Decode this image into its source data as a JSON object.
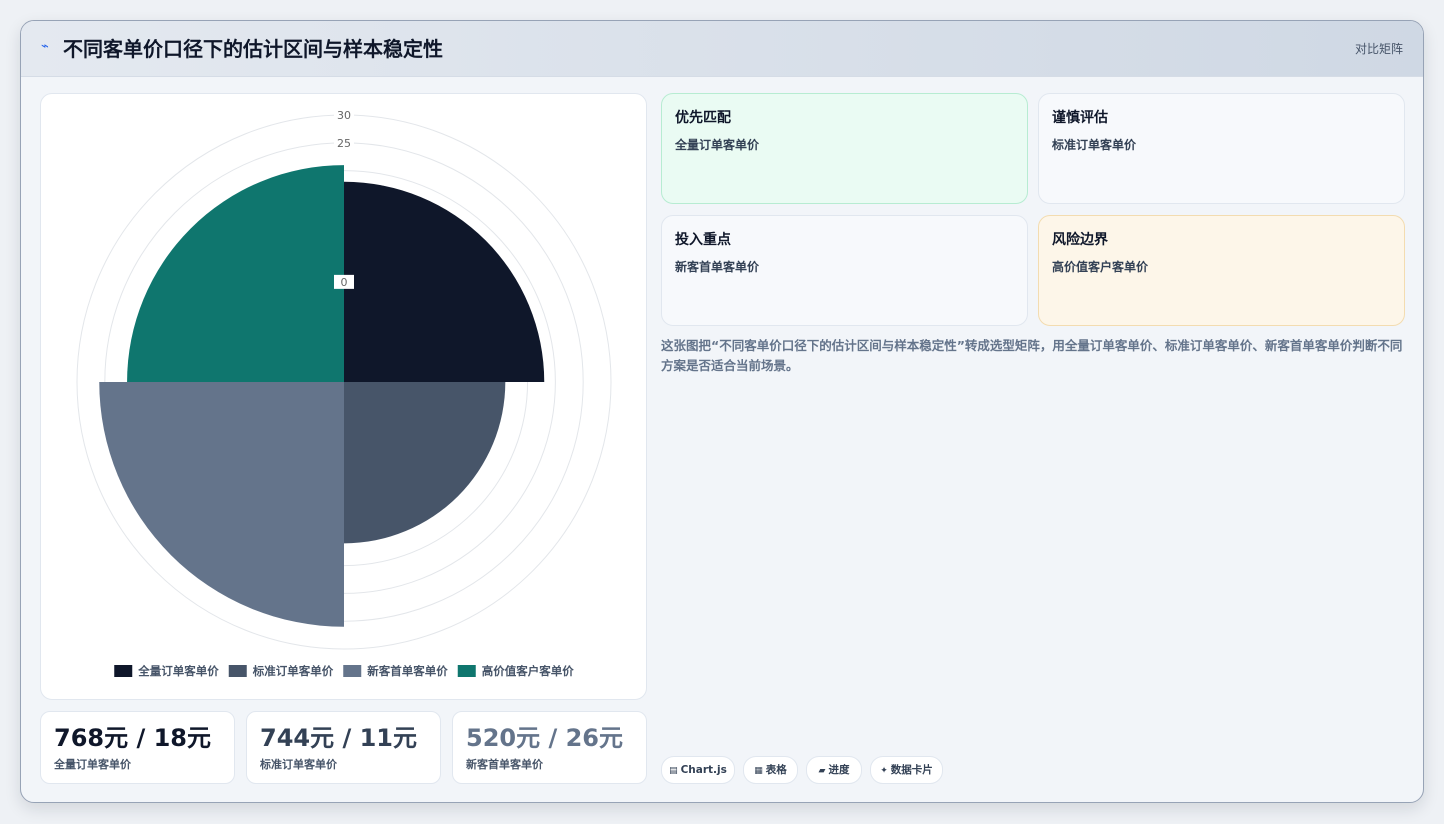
{
  "header": {
    "title": "不同客单价口径下的估计区间与样本稳定性",
    "right_link": "对比矩阵",
    "logo_icon": "pulse-icon"
  },
  "chart_data": {
    "type": "polarArea",
    "categories": [
      "全量订单客单价",
      "标准订单客单价",
      "新客首单客单价",
      "高价值客户客单价"
    ],
    "values": [
      18,
      11,
      26,
      21
    ],
    "colors": [
      "#0f172a",
      "#475569",
      "#64748b",
      "#0f766e"
    ],
    "radial_ticks": [
      0,
      25,
      30
    ],
    "rlim": [
      -18,
      30
    ],
    "legend_position": "bottom",
    "grid": true
  },
  "kpis": [
    {
      "value": "768元 / 18元",
      "label": "全量订单客单价",
      "color": "#0f172a"
    },
    {
      "value": "744元 / 11元",
      "label": "标准订单客单价",
      "color": "#334155"
    },
    {
      "value": "520元 / 26元",
      "label": "新客首单客单价",
      "color": "#64748b"
    }
  ],
  "tiles": [
    {
      "title": "优先匹配",
      "subtitle": "全量订单客单价"
    },
    {
      "title": "谨慎评估",
      "subtitle": "标准订单客单价"
    },
    {
      "title": "投入重点",
      "subtitle": "新客首单客单价"
    },
    {
      "title": "风险边界",
      "subtitle": "高价值客户客单价"
    }
  ],
  "description": "这张图把“不同客单价口径下的估计区间与样本稳定性”转成选型矩阵，用全量订单客单价、标准订单客单价、新客首单客单价判断不同方案是否适合当前场景。",
  "chips": [
    {
      "icon": "chart-icon",
      "label": "Chart.js"
    },
    {
      "icon": "table-icon",
      "label": "表格"
    },
    {
      "icon": "progress-icon",
      "label": "进度"
    },
    {
      "icon": "card-icon",
      "label": "数据卡片"
    }
  ]
}
